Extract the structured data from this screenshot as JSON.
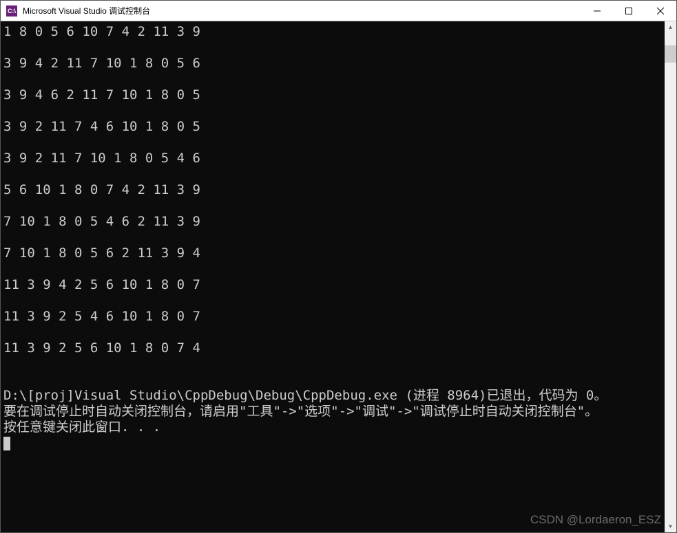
{
  "window": {
    "icon_text": "C:\\",
    "title": "Microsoft Visual Studio 调试控制台"
  },
  "console": {
    "output_lines": [
      "1 8 0 5 6 10 7 4 2 11 3 9",
      "",
      "3 9 4 2 11 7 10 1 8 0 5 6",
      "",
      "3 9 4 6 2 11 7 10 1 8 0 5",
      "",
      "3 9 2 11 7 4 6 10 1 8 0 5",
      "",
      "3 9 2 11 7 10 1 8 0 5 4 6",
      "",
      "5 6 10 1 8 0 7 4 2 11 3 9",
      "",
      "7 10 1 8 0 5 4 6 2 11 3 9",
      "",
      "7 10 1 8 0 5 6 2 11 3 9 4",
      "",
      "11 3 9 4 2 5 6 10 1 8 0 7",
      "",
      "11 3 9 2 5 4 6 10 1 8 0 7",
      "",
      "11 3 9 2 5 6 10 1 8 0 7 4",
      "",
      ""
    ],
    "exit_message": "D:\\[proj]Visual Studio\\CppDebug\\Debug\\CppDebug.exe (进程 8964)已退出，代码为 0。",
    "auto_close_hint": "要在调试停止时自动关闭控制台，请启用\"工具\"->\"选项\"->\"调试\"->\"调试停止时自动关闭控制台\"。",
    "press_any_key": "按任意键关闭此窗口. . ."
  },
  "watermark": "CSDN @Lordaeron_ESZ"
}
